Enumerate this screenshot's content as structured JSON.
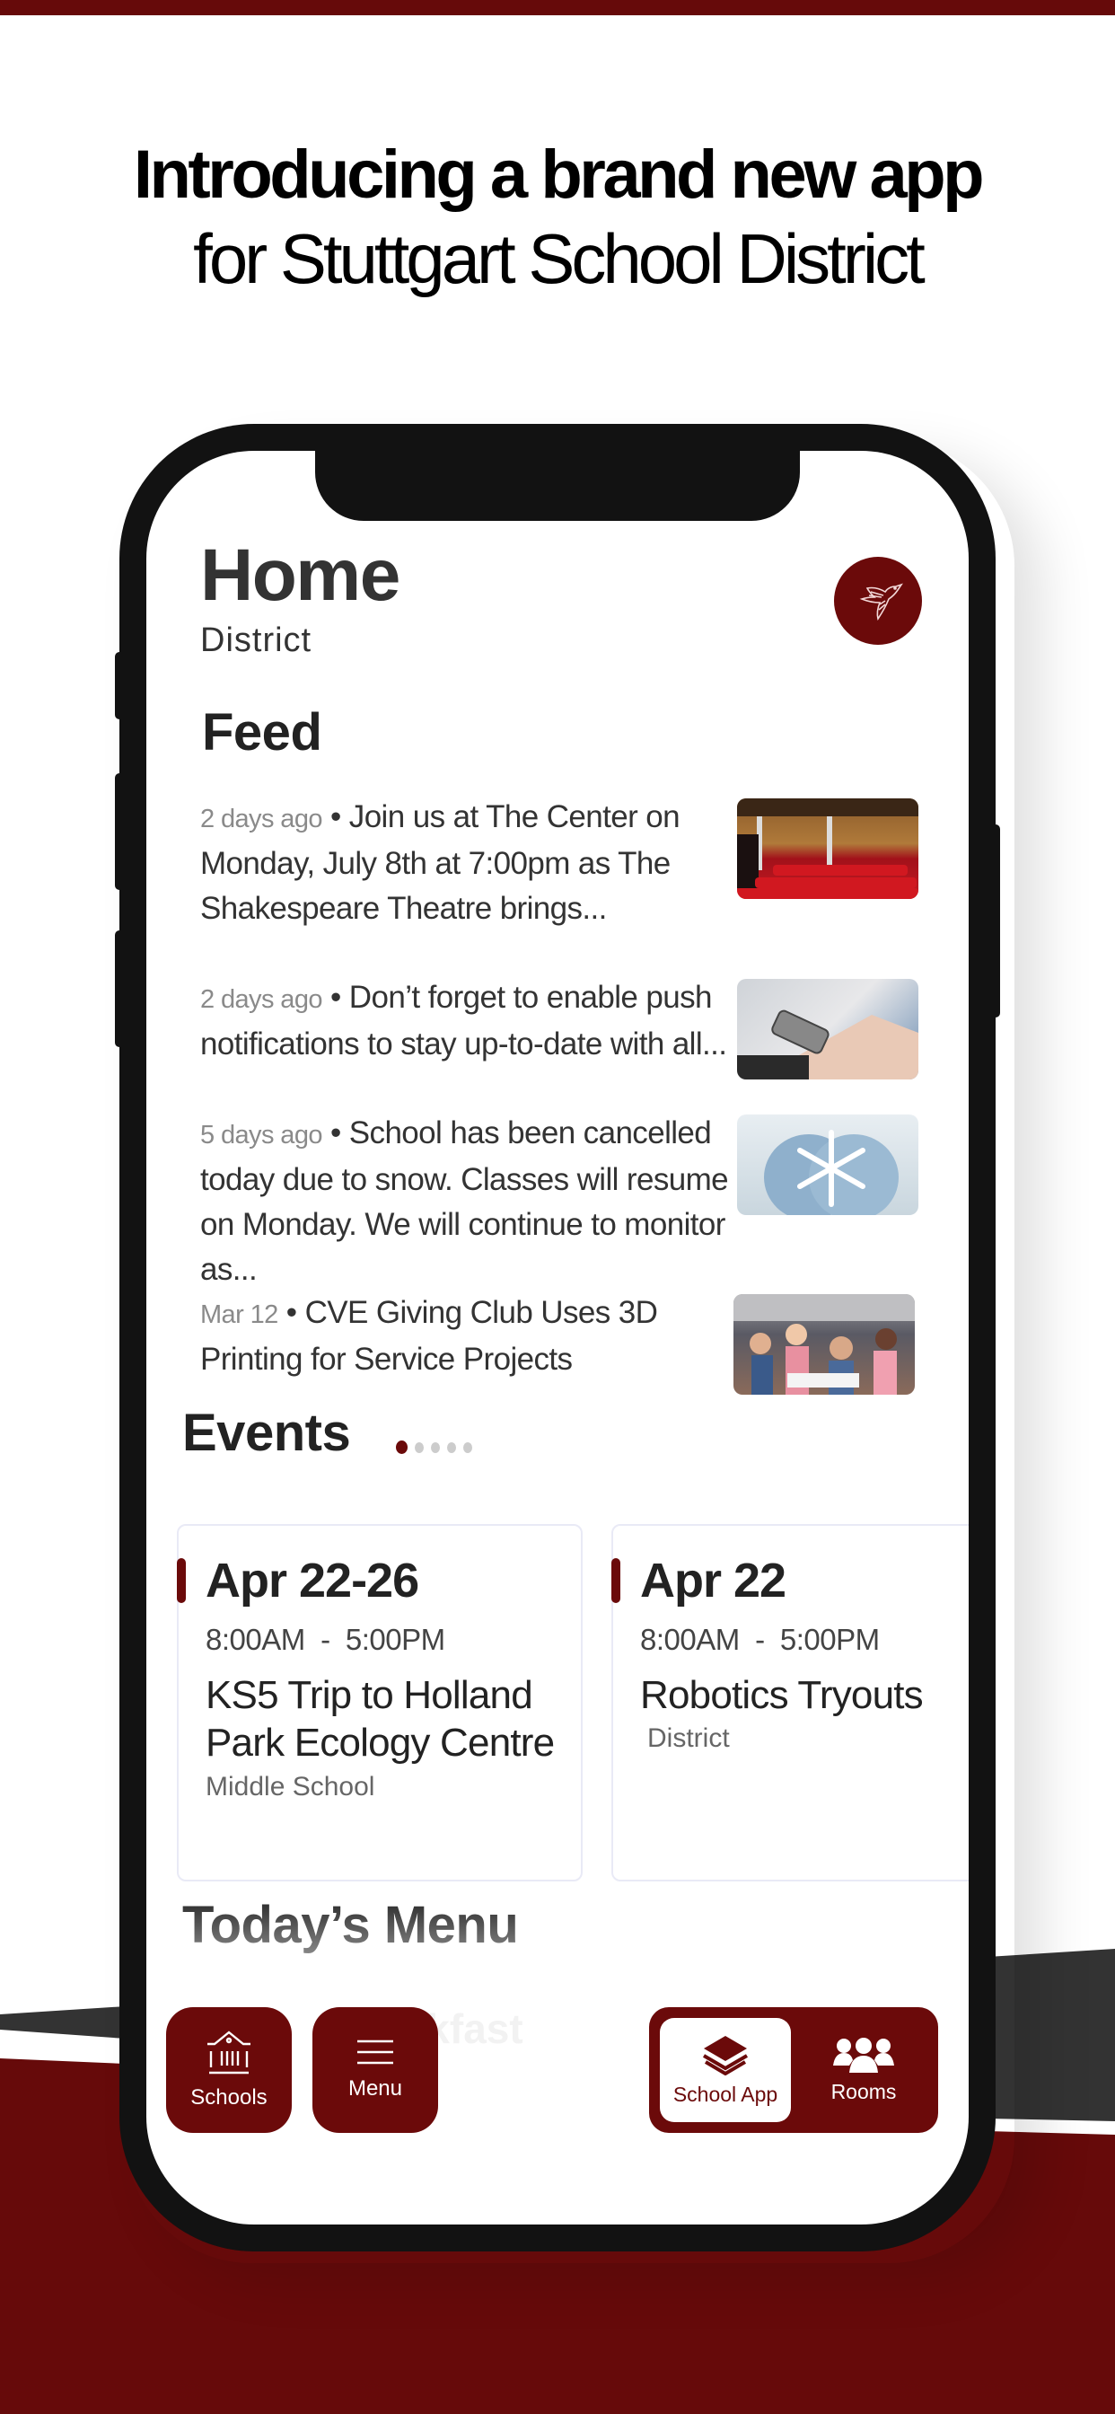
{
  "promo": {
    "headline_bold": "Introducing a brand new app",
    "headline_regular": "for Stuttgart School District"
  },
  "colors": {
    "brand": "#6b0a0a",
    "top_bar": "#660a0a",
    "dark_band": "#333333",
    "phone_frame": "#121212"
  },
  "header": {
    "title": "Home",
    "subtitle": "District",
    "logo_icon": "bird-logo-icon"
  },
  "feed": {
    "heading": "Feed",
    "items": [
      {
        "time": "2 days ago",
        "text": "Join us at The Center on Monday, July 8th at 7:00pm as The Shakespeare Theatre brings...",
        "image": "theatre-seats-image"
      },
      {
        "time": "2 days ago",
        "text": "Don’t forget to enable push notifications to stay up-to-date with all...",
        "image": "phone-in-hand-image"
      },
      {
        "time": "5 days ago",
        "text": "School has been cancelled today due to snow. Classes will resume on Monday. We will continue to monitor as...",
        "image": "snowflake-mittens-image"
      },
      {
        "time": "Mar 12",
        "text": "CVE Giving Club Uses 3D Printing for Service Projects",
        "image": "classroom-students-image"
      }
    ],
    "separator": "•"
  },
  "events": {
    "heading": "Events",
    "pager": {
      "total": 5,
      "active_index": 0
    },
    "cards": [
      {
        "date": "Apr 22-26",
        "time": "8:00AM  -  5:00PM",
        "title": "KS5 Trip to Holland Park Ecology Centre",
        "location": "Middle School"
      },
      {
        "date": "Apr 22",
        "time": "8:00AM  -  5:00PM",
        "title": "Robotics Tryouts",
        "location": "District"
      }
    ]
  },
  "todays_menu": {
    "heading": "Today’s Menu",
    "faded_text": "Breakfast"
  },
  "bottom_nav": {
    "schools": {
      "label": "Schools",
      "icon": "school-building-icon"
    },
    "menu": {
      "label": "Menu",
      "icon": "hamburger-menu-icon"
    },
    "tabs": [
      {
        "label": "School App",
        "icon": "layers-stack-icon",
        "active": true
      },
      {
        "label": "Rooms",
        "icon": "people-group-icon",
        "active": false
      }
    ]
  }
}
